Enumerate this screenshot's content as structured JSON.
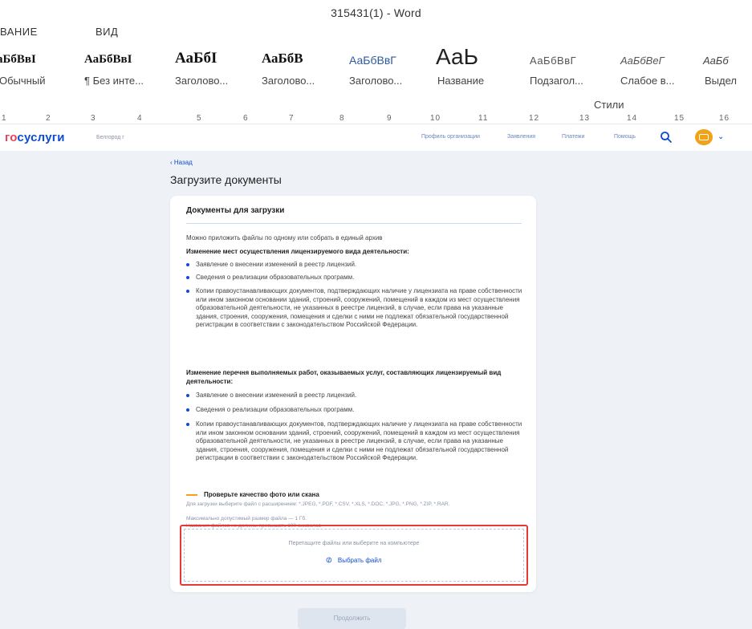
{
  "word": {
    "window_title": "315431(1) - Word",
    "tabs": [
      "ВАНИЕ",
      "ВИД"
    ],
    "styles": [
      {
        "preview": "аБбВвІ",
        "name": "Обычный"
      },
      {
        "preview": "АаБбВвІ",
        "name": "¶ Без инте..."
      },
      {
        "preview": "АаБбІ",
        "name": "Заголово..."
      },
      {
        "preview": "АаБбВ",
        "name": "Заголово..."
      },
      {
        "preview": "АаБбВвГ",
        "name": "Заголово..."
      },
      {
        "preview": "АаЬ",
        "name": "Название"
      },
      {
        "preview": "АаБбВвГ",
        "name": "Подзагол..."
      },
      {
        "preview": "АаБбВеГ",
        "name": "Слабое в..."
      },
      {
        "preview": "АаБб",
        "name": "Выдел"
      }
    ],
    "styles_group_label": "Стили",
    "ruler_numbers": [
      "1",
      "2",
      "3",
      "4",
      "5",
      "6",
      "7",
      "8",
      "9",
      "10",
      "11",
      "12",
      "13",
      "14",
      "15",
      "16"
    ]
  },
  "site": {
    "logo_part1": "го",
    "logo_part2": "суслуги",
    "city": "Белгород г",
    "nav": [
      "Профиль организации",
      "Заявления",
      "Платежи",
      "Помощь"
    ],
    "back": "‹  Назад",
    "page_title": "Загрузите документы",
    "card": {
      "title": "Документы для загрузки",
      "intro": "Можно приложить файлы по одному или собрать в единый архив",
      "section1": {
        "title": "Изменение мест осуществления лицензируемого вида деятельности:",
        "items": [
          "Заявление о внесении изменений в реестр лицензий.",
          "Сведения о реализации образовательных программ.",
          "Копии правоустанавливающих документов, подтверждающих наличие у лицензиата на праве собственности или ином законном основании зданий, строений, сооружений, помещений в каждом из мест осуществления образовательной деятельности, не указанных в реестре лицензий, в случае, если права на указанные здания, строения, сооружения, помещения и сделки с ними не подлежат обязательной государственной регистрации в соответствии с законодательством Российской Федерации."
        ]
      },
      "section2": {
        "title": "Изменение перечня выполняемых работ, оказываемых услуг, составляющих лицензируемый вид деятельности:",
        "items": [
          "Заявление о внесении изменений в реестр лицензий.",
          "Сведения о реализации образовательных программ.",
          "Копии правоустанавливающих документов, подтверждающих наличие у лицензиата на праве собственности или ином законном основании зданий, строений, сооружений, помещений в каждом из мест осуществления образовательной деятельности, не указанных в реестре лицензий, в случае, если права на указанные здания, строения, сооружения, помещения и сделки с ними не подлежат обязательной государственной регистрации в соответствии с законодательством Российской Федерации."
        ]
      },
      "quality_title": "Проверьте качество фото или скана",
      "format_note": "Для загрузки выберите файл с расширением: *.JPEG, *.PDF, *.CSV, *.XLS, *.DOC, *.JPG, *.PNG, *.ZIP, *.RAR.",
      "size_note": "Максимально допустимый размер файла — 1 Гб.",
      "name_note": "Названия файлов не должны превышать 100 символов",
      "dropzone_text": "Перетащите файлы или выберите на компьютере",
      "pick_file": "Выбрать файл"
    },
    "continue": "Продолжить"
  },
  "colors": {
    "brand_blue": "#0d4cd3",
    "brand_red": "#ee3f58",
    "highlight_red": "#e53935",
    "accent_orange": "#f0a319",
    "page_bg": "#eef1f6"
  }
}
